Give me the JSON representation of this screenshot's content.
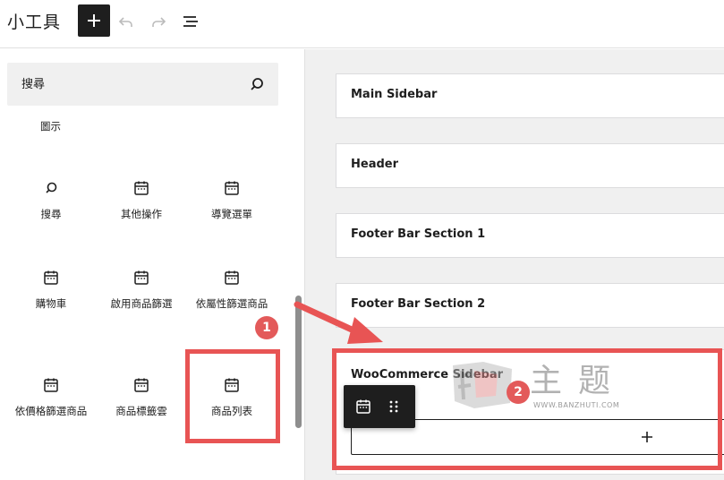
{
  "app": {
    "title": "小工具"
  },
  "toolbar": {
    "add_icon": "plus-icon",
    "undo_icon": "undo-icon",
    "redo_icon": "redo-icon",
    "list_view_icon": "list-view-icon"
  },
  "inserter": {
    "search_placeholder": "搜尋",
    "partial_label": "圖示",
    "blocks": [
      {
        "label": "搜尋",
        "icon": "search-icon"
      },
      {
        "label": "其他操作",
        "icon": "calendar-icon"
      },
      {
        "label": "導覽選單",
        "icon": "calendar-icon"
      },
      {
        "label": "購物車",
        "icon": "calendar-icon"
      },
      {
        "label": "啟用商品篩選",
        "icon": "calendar-icon"
      },
      {
        "label": "依屬性篩選商品",
        "icon": "calendar-icon"
      },
      {
        "label": "依價格篩選商品",
        "icon": "calendar-icon"
      },
      {
        "label": "商品標籤雲",
        "icon": "calendar-icon"
      },
      {
        "label": "商品列表",
        "icon": "calendar-icon"
      }
    ]
  },
  "widget_areas": [
    {
      "title": "Main Sidebar"
    },
    {
      "title": "Header"
    },
    {
      "title": "Footer Bar Section 1"
    },
    {
      "title": "Footer Bar Section 2"
    },
    {
      "title": "WooCommerce Sidebar"
    }
  ],
  "annotations": {
    "step1": "1",
    "step2": "2",
    "color": "#e85454"
  },
  "watermark": {
    "chars": "主题",
    "url": "WWW.BANZHUTI.COM"
  }
}
